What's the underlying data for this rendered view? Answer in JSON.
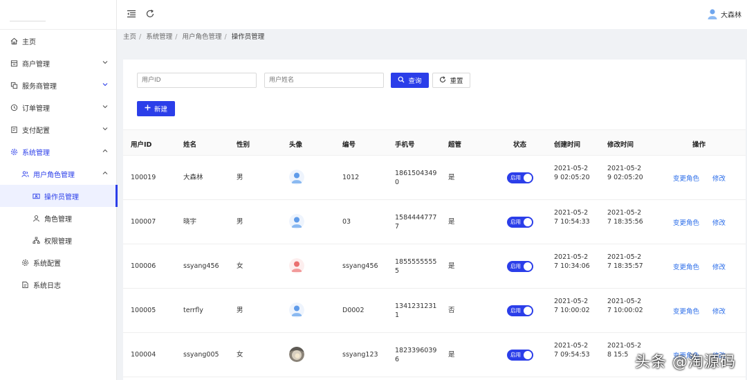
{
  "sidebar": {
    "items": [
      {
        "label": "主页",
        "icon": "home-icon"
      },
      {
        "label": "商户管理",
        "icon": "store-icon"
      },
      {
        "label": "服务商管理",
        "icon": "copy-icon"
      },
      {
        "label": "订单管理",
        "icon": "clock-icon"
      },
      {
        "label": "支付配置",
        "icon": "file-icon"
      },
      {
        "label": "系统管理",
        "icon": "gear-icon"
      },
      {
        "label": "用户角色管理",
        "icon": "users-icon"
      },
      {
        "label": "操作员管理",
        "icon": "id-card-icon"
      },
      {
        "label": "角色管理",
        "icon": "user-icon"
      },
      {
        "label": "权限管理",
        "icon": "tree-icon"
      },
      {
        "label": "系统配置",
        "icon": "gear-icon"
      },
      {
        "label": "系统日志",
        "icon": "log-icon"
      }
    ]
  },
  "header": {
    "username": "大森林"
  },
  "breadcrumb": [
    "主页",
    "系统管理",
    "用户角色管理",
    "操作员管理"
  ],
  "search": {
    "id_placeholder": "用户ID",
    "name_placeholder": "用户姓名",
    "query_label": "查询",
    "reset_label": "重置",
    "new_label": "新建"
  },
  "table": {
    "columns": [
      "用户ID",
      "姓名",
      "性别",
      "头像",
      "编号",
      "手机号",
      "超管",
      "状态",
      "创建时间",
      "修改时间",
      "操作"
    ],
    "toggle_label": "启用",
    "action_role": "变更角色",
    "action_edit": "修改",
    "rows": [
      {
        "id": "100019",
        "name": "大森林",
        "gender": "男",
        "avatar": "male",
        "code": "1012",
        "phone": "18615043490",
        "admin": "是",
        "created": "2021-05-29 02:05:20",
        "modified": "2021-05-29 02:05:20"
      },
      {
        "id": "100007",
        "name": "晓宇",
        "gender": "男",
        "avatar": "male",
        "code": "03",
        "phone": "15844447777",
        "admin": "是",
        "created": "2021-05-27 10:54:33",
        "modified": "2021-05-27 18:35:56"
      },
      {
        "id": "100006",
        "name": "ssyang456",
        "gender": "女",
        "avatar": "female",
        "code": "ssyang456",
        "phone": "18555555555",
        "admin": "是",
        "created": "2021-05-27 10:34:06",
        "modified": "2021-05-27 18:35:57"
      },
      {
        "id": "100005",
        "name": "terrfly",
        "gender": "男",
        "avatar": "male",
        "code": "D0002",
        "phone": "13412312311",
        "admin": "否",
        "created": "2021-05-27 10:00:02",
        "modified": "2021-05-27 10:00:02"
      },
      {
        "id": "100004",
        "name": "ssyang005",
        "gender": "女",
        "avatar": "photo",
        "code": "ssyang123",
        "phone": "18233960396",
        "admin": "是",
        "created": "2021-05-27 09:54:53",
        "modified": "2021-05-28 15:5"
      }
    ]
  },
  "watermark": "头条 @淘源码",
  "colors": {
    "accent": "#2b3ee9",
    "link": "#2b6de9"
  }
}
